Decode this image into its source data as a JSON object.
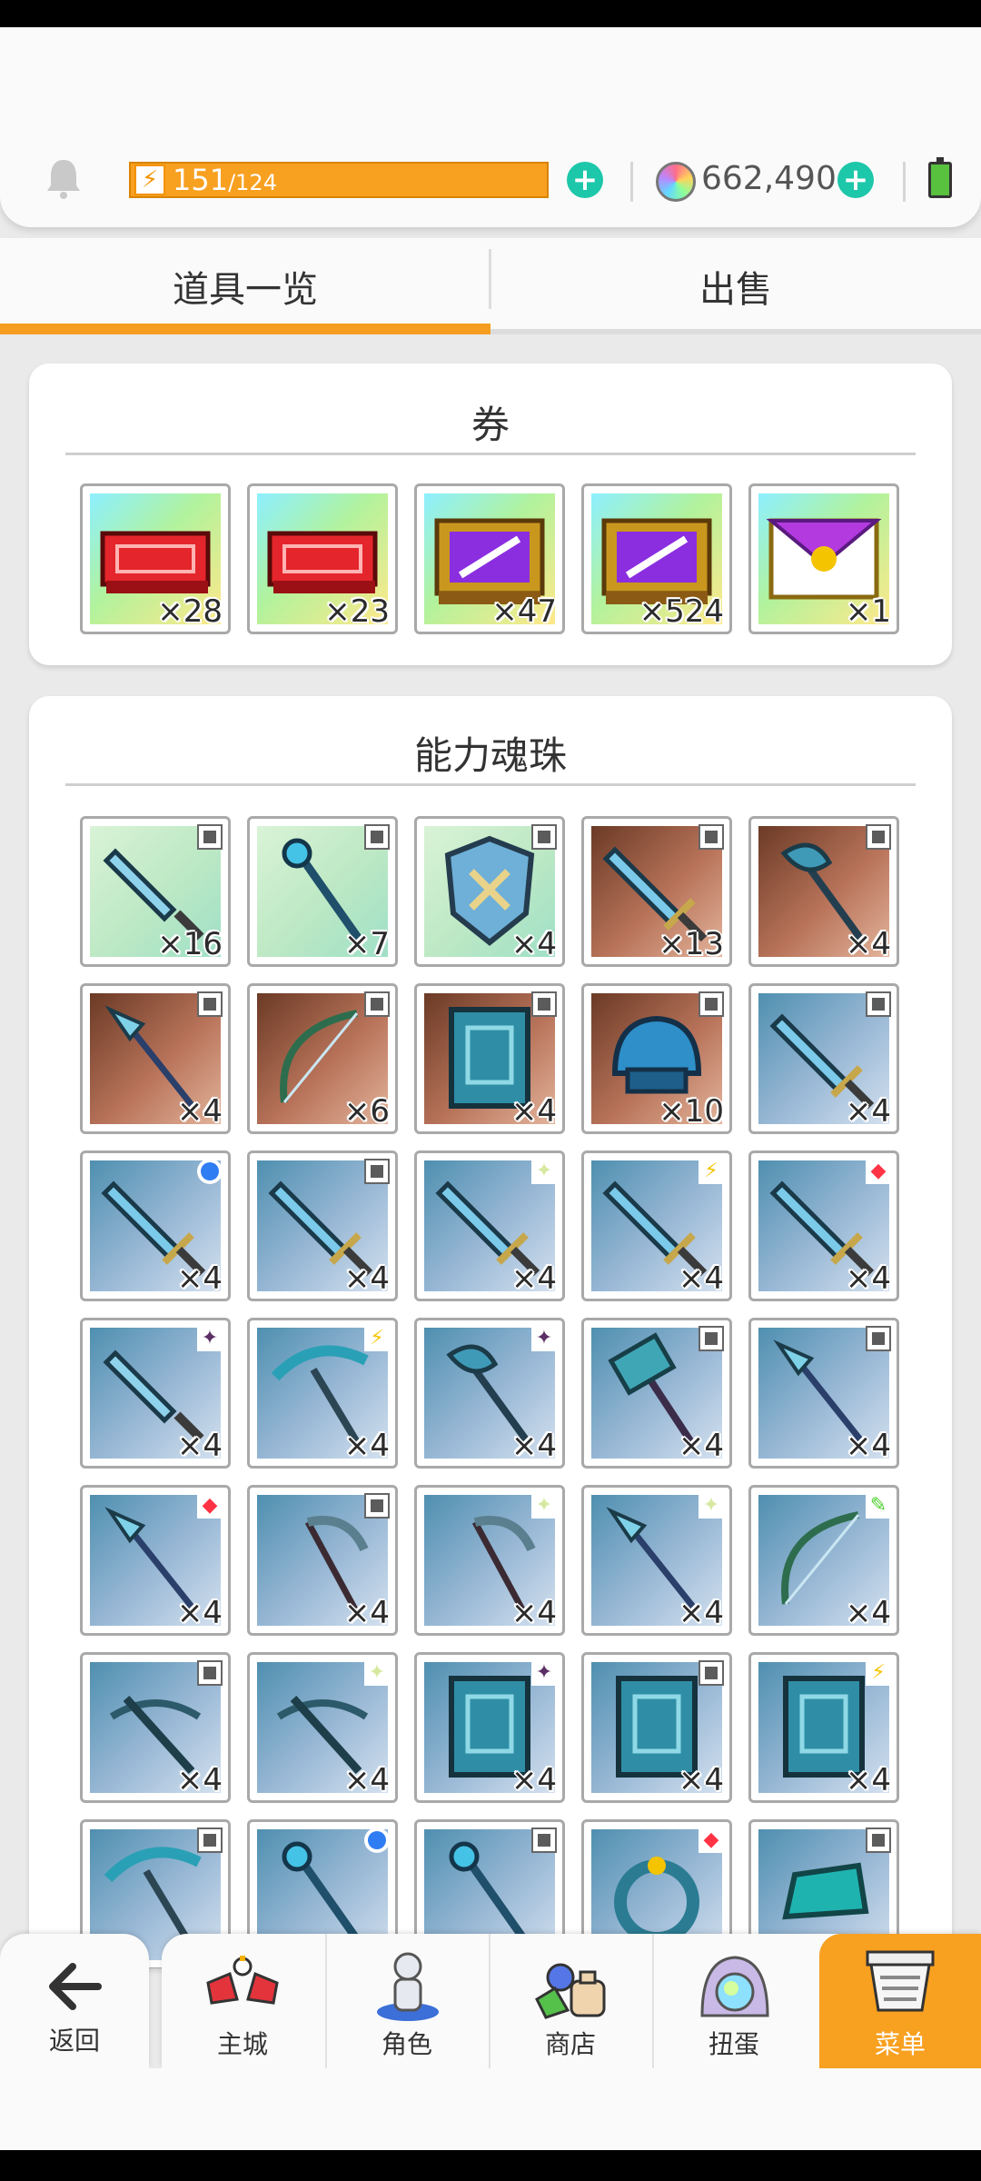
{
  "header": {
    "stamina_current": "151",
    "stamina_max": "/124",
    "gems": "662,490"
  },
  "tabs": {
    "items": "道具一览",
    "sell": "出售",
    "active": "items"
  },
  "vouchers": {
    "title": "券",
    "items": [
      {
        "icon": "red-ticket-icon",
        "qty": "×28"
      },
      {
        "icon": "red-ticket-icon",
        "qty": "×23"
      },
      {
        "icon": "purple-sword-ticket-icon",
        "qty": "×47"
      },
      {
        "icon": "purple-sword-ticket-icon",
        "qty": "×524"
      },
      {
        "icon": "gold-envelope-icon",
        "qty": "×1"
      }
    ]
  },
  "orbs": {
    "title": "能力魂珠",
    "items": [
      {
        "icon": "dagger-icon",
        "qty": "×16",
        "bg": "green",
        "badge": "gray"
      },
      {
        "icon": "wand-icon",
        "qty": "×7",
        "bg": "green",
        "badge": "gray"
      },
      {
        "icon": "shield-icon",
        "qty": "×4",
        "bg": "green",
        "badge": "gray"
      },
      {
        "icon": "sword-icon",
        "qty": "×13",
        "bg": "brown",
        "badge": "gray"
      },
      {
        "icon": "axe-icon",
        "qty": "×4",
        "bg": "brown",
        "badge": "gray"
      },
      {
        "icon": "spear-icon",
        "qty": "×4",
        "bg": "brown",
        "badge": "gray"
      },
      {
        "icon": "bow-icon",
        "qty": "×6",
        "bg": "brown",
        "badge": "gray"
      },
      {
        "icon": "book-icon",
        "qty": "×4",
        "bg": "brown",
        "badge": "gray"
      },
      {
        "icon": "helmet-icon",
        "qty": "×10",
        "bg": "brown",
        "badge": "gray"
      },
      {
        "icon": "sword-icon",
        "qty": "×4",
        "bg": "blue",
        "badge": "gray"
      },
      {
        "icon": "sword-icon",
        "qty": "×4",
        "bg": "blue",
        "badge": "blue"
      },
      {
        "icon": "sword-icon",
        "qty": "×4",
        "bg": "blue",
        "badge": "gray"
      },
      {
        "icon": "sword-icon",
        "qty": "×4",
        "bg": "blue",
        "badge": "light"
      },
      {
        "icon": "sword-icon",
        "qty": "×4",
        "bg": "blue",
        "badge": "yellow"
      },
      {
        "icon": "sword-icon",
        "qty": "×4",
        "bg": "blue",
        "badge": "red"
      },
      {
        "icon": "dagger-icon",
        "qty": "×4",
        "bg": "blue",
        "badge": "dark"
      },
      {
        "icon": "pickaxe-icon",
        "qty": "×4",
        "bg": "blue",
        "badge": "yellow"
      },
      {
        "icon": "axe-icon",
        "qty": "×4",
        "bg": "blue",
        "badge": "dark"
      },
      {
        "icon": "hammer-icon",
        "qty": "×4",
        "bg": "blue",
        "badge": "gray"
      },
      {
        "icon": "spear-icon",
        "qty": "×4",
        "bg": "blue",
        "badge": "gray"
      },
      {
        "icon": "spear-icon",
        "qty": "×4",
        "bg": "blue",
        "badge": "red"
      },
      {
        "icon": "scythe-icon",
        "qty": "×4",
        "bg": "blue",
        "badge": "gray"
      },
      {
        "icon": "scythe-icon",
        "qty": "×4",
        "bg": "blue",
        "badge": "light"
      },
      {
        "icon": "spear-icon",
        "qty": "×4",
        "bg": "blue",
        "badge": "light"
      },
      {
        "icon": "bow-icon",
        "qty": "×4",
        "bg": "blue",
        "badge": "green"
      },
      {
        "icon": "crossbow-icon",
        "qty": "×4",
        "bg": "blue",
        "badge": "gray"
      },
      {
        "icon": "crossbow-icon",
        "qty": "×4",
        "bg": "blue",
        "badge": "light"
      },
      {
        "icon": "book-icon",
        "qty": "×4",
        "bg": "blue",
        "badge": "dark"
      },
      {
        "icon": "book-icon",
        "qty": "×4",
        "bg": "blue",
        "badge": "gray"
      },
      {
        "icon": "book-icon",
        "qty": "×4",
        "bg": "blue",
        "badge": "yellow"
      },
      {
        "icon": "pickaxe-icon",
        "qty": "",
        "bg": "blue",
        "badge": "gray"
      },
      {
        "icon": "wand-icon",
        "qty": "",
        "bg": "blue",
        "badge": "blue"
      },
      {
        "icon": "wand-icon",
        "qty": "",
        "bg": "blue",
        "badge": "gray"
      },
      {
        "icon": "ring-icon",
        "qty": "",
        "bg": "blue",
        "badge": "red"
      },
      {
        "icon": "glove-icon",
        "qty": "",
        "bg": "blue",
        "badge": "gray"
      }
    ]
  },
  "nav": {
    "back": "返回",
    "town": "主城",
    "character": "角色",
    "shop": "商店",
    "gacha": "扭蛋",
    "menu": "菜单"
  },
  "colors": {
    "accent": "#f8a020",
    "plus": "#1dc7a9",
    "frame": "#a9a9a9"
  }
}
